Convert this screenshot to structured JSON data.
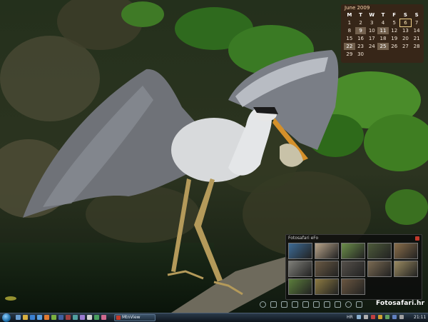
{
  "calendar": {
    "title": "June 2009",
    "weekdays": [
      "M",
      "T",
      "W",
      "T",
      "F",
      "S",
      "S"
    ],
    "days": [
      "1",
      "2",
      "3",
      "4",
      "5",
      "6",
      "7",
      "8",
      "9",
      "10",
      "11",
      "12",
      "13",
      "14",
      "15",
      "16",
      "17",
      "18",
      "19",
      "20",
      "21",
      "22",
      "23",
      "24",
      "25",
      "26",
      "27",
      "28",
      "29",
      "30",
      "",
      "",
      "",
      "",
      ""
    ],
    "highlighted_days": [
      "9",
      "11",
      "22",
      "25"
    ],
    "today": "6"
  },
  "gallery": {
    "title": "Fotosafari eFo",
    "thumb_colors": [
      "#3d6b96",
      "#b8a48a",
      "#6c8f4a",
      "#4d5a3a",
      "#8a6e4a",
      "#7e7e78",
      "#6a5a44",
      "#55504a",
      "#7a6a52",
      "#9a8a60",
      "#5c7e3c",
      "#8c7a42",
      "#6a5640",
      "",
      ""
    ]
  },
  "dock": {
    "brand": "Fotosafari.hr",
    "icons": [
      "refresh-icon",
      "home-icon",
      "folder-icon",
      "list-icon",
      "back-icon",
      "forward-icon",
      "grid-icon",
      "settings-icon",
      "info-icon",
      "close-icon"
    ]
  },
  "taskbar": {
    "task_label": "MtnView",
    "language": "HR",
    "clock": "21:11"
  },
  "colors": {
    "calendar_bg": "#462014",
    "gallery_bg": "#0c0c0c",
    "taskbar": "#1a2633",
    "accent_red": "#c0392b"
  }
}
